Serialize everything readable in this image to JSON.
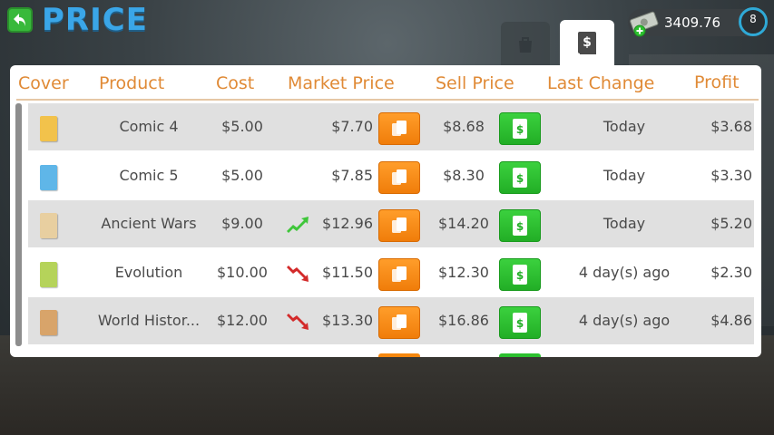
{
  "screen": {
    "title": "PRICE",
    "money": "3409.76",
    "level": "8"
  },
  "table": {
    "headers": {
      "cover": "Cover",
      "product": "Product",
      "cost": "Cost",
      "market_price": "Market Price",
      "sell_price": "Sell Price",
      "last_change": "Last Change",
      "profit": "Profit"
    },
    "rows": [
      {
        "product": "Comic 4",
        "cost": "$5.00",
        "market": "$7.70",
        "trend": "none",
        "sell": "$8.68",
        "last_change": "Today",
        "profit": "$3.68",
        "cover_color": "#f2c24b"
      },
      {
        "product": "Comic 5",
        "cost": "$5.00",
        "market": "$7.85",
        "trend": "none",
        "sell": "$8.30",
        "last_change": "Today",
        "profit": "$3.30",
        "cover_color": "#5fb6e8"
      },
      {
        "product": "Ancient Wars",
        "cost": "$9.00",
        "market": "$12.96",
        "trend": "up",
        "sell": "$14.20",
        "last_change": "Today",
        "profit": "$5.20",
        "cover_color": "#e8cfa0"
      },
      {
        "product": "Evolution",
        "cost": "$10.00",
        "market": "$11.50",
        "trend": "down",
        "sell": "$12.30",
        "last_change": "4 day(s) ago",
        "profit": "$2.30",
        "cover_color": "#b5d35a"
      },
      {
        "product": "World Histor...",
        "cost": "$12.00",
        "market": "$13.30",
        "trend": "down",
        "sell": "$16.86",
        "last_change": "4 day(s) ago",
        "profit": "$4.86",
        "cover_color": "#d8a46a"
      }
    ]
  },
  "colors": {
    "title": "#3aa6e8",
    "header_text": "#e08a36",
    "copy_button": "#f5870e",
    "sell_button": "#2cc02f",
    "trend_up": "#3fc63a",
    "trend_down": "#d32a2a"
  }
}
